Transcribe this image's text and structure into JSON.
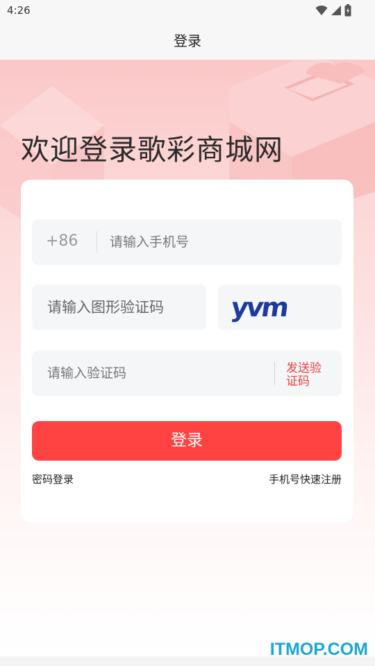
{
  "status_bar": {
    "time": "4:26",
    "icons": [
      "wifi-icon",
      "signal-icon",
      "battery-icon"
    ]
  },
  "app_bar": {
    "title": "登录"
  },
  "hero": {
    "welcome_text": "欢迎登录歌彩商城网"
  },
  "form": {
    "country_code": "+86",
    "phone_placeholder": "请输入手机号",
    "captcha_placeholder": "请输入图形验证码",
    "captcha_image_text": "yvm",
    "sms_placeholder": "请输入验证码",
    "sms_send_label": "发送验证码",
    "login_button_label": "登录",
    "password_login_link": "密码登录",
    "register_link": "手机号快速注册"
  },
  "watermark": "ITMOP.COM",
  "colors": {
    "accent": "#ff4343",
    "link_red": "#f04040",
    "field_bg": "#f5f6f8",
    "watermark": "#1aa6d6"
  }
}
